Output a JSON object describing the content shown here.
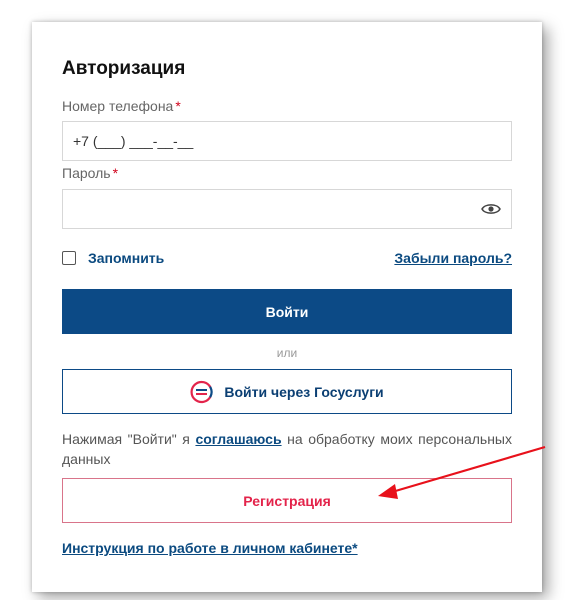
{
  "form": {
    "title": "Авторизация",
    "phone_label": "Номер телефона",
    "phone_value": "+7 (___) ___-__-__",
    "password_label": "Пароль",
    "required_mark": "*",
    "password_value": "",
    "remember_label": "Запомнить",
    "forgot_link": "Забыли пароль?",
    "login_button": "Войти",
    "or_text": "или",
    "gosuslugi_button": "Войти через Госуслуги",
    "consent_before": "Нажимая \"Войти\" я ",
    "consent_link": "соглашаюсь",
    "consent_after": " на обработку моих персональных данных",
    "register_button": "Регистрация",
    "instructions_link": "Инструкция по работе в личном кабинете*"
  },
  "icons": {
    "password_toggle": "eye-icon",
    "gosuslugi": "gosuslugi-logo-icon",
    "checkbox": "checkbox-unchecked"
  },
  "colors": {
    "primary": "#0c4a86",
    "link": "#0b4a80",
    "required": "#d0021b",
    "register": "#e3244b",
    "annotation_arrow": "#e8111b"
  }
}
